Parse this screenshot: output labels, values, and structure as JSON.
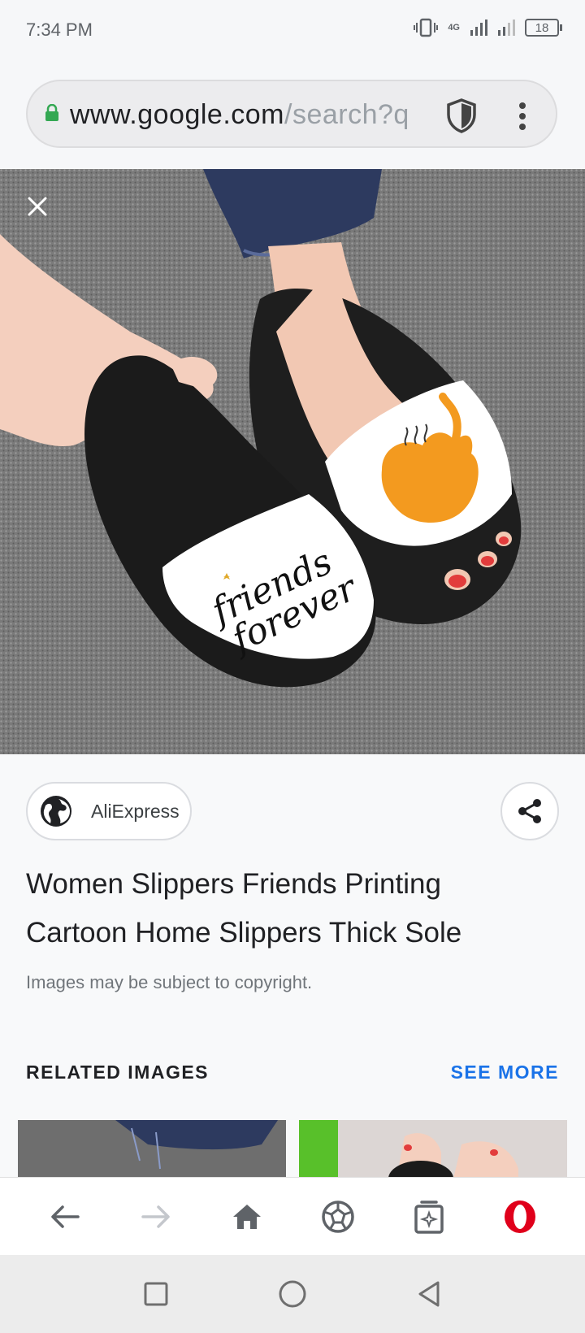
{
  "status_bar": {
    "time": "7:34 PM",
    "network_type": "4G",
    "battery": "18"
  },
  "browser": {
    "url_host": "www.google.com",
    "url_path": "/search?q",
    "lock_icon": "lock-icon",
    "shield_icon": "shield-icon",
    "menu_icon": "more-vert-icon"
  },
  "viewer": {
    "close_icon": "close-icon",
    "image_description_icon": "product-photo",
    "image_text": {
      "left_slipper_line1": "friends",
      "left_slipper_line2": "forever"
    }
  },
  "result": {
    "source_name": "AliExpress",
    "title_line1": "Women Slippers Friends Printing",
    "title_line2": "Cartoon Home Slippers Thick Sole",
    "copyright_notice": "Images may be subject to copyright.",
    "related_header": "RELATED IMAGES",
    "see_more": "SEE MORE"
  },
  "bottom_nav": {
    "items": [
      "back-icon",
      "forward-icon",
      "home-icon",
      "speed-dial-icon",
      "tabs-icon",
      "opera-menu-icon"
    ]
  },
  "system_nav": {
    "items": [
      "recents-icon",
      "home-circle-icon",
      "system-back-icon"
    ]
  },
  "colors": {
    "accent": "#1a73e8",
    "lock_green": "#34a853",
    "opera_red": "#e0001b"
  }
}
